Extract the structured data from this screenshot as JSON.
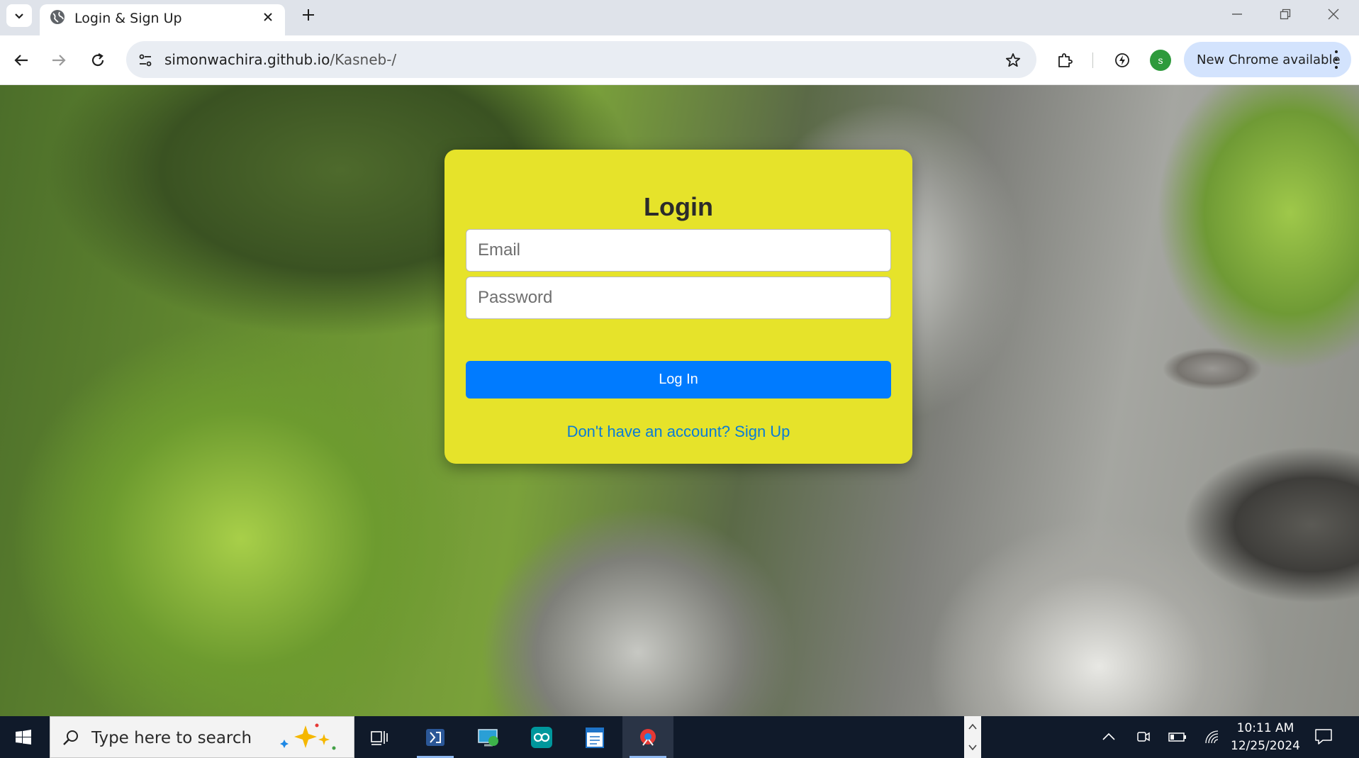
{
  "browser": {
    "tab_title": "Login & Sign Up",
    "url_host": "simonwachira.github.io",
    "url_path": "/Kasneb-/",
    "profile_initial": "s",
    "update_label": "New Chrome available"
  },
  "login": {
    "title": "Login",
    "email_placeholder": "Email",
    "password_placeholder": "Password",
    "submit_label": "Log In",
    "signup_link": "Don't have an account? Sign Up"
  },
  "taskbar": {
    "search_placeholder": "Type here to search",
    "time": "10:11 AM",
    "date": "12/25/2024"
  },
  "colors": {
    "card": "#e6e32a",
    "button": "#007bff",
    "link": "#0a7bd6",
    "taskbar": "#101a2a"
  }
}
